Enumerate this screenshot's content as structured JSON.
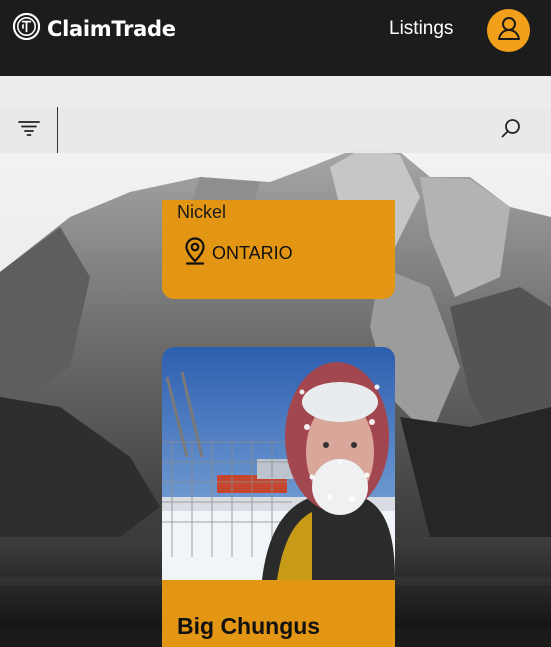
{
  "nav": {
    "brand": "ClaimTrade",
    "links": [
      "Listings"
    ]
  },
  "search": {
    "placeholder": "",
    "value": ""
  },
  "listings": [
    {
      "mineral": "Nickel",
      "location": "ONTARIO"
    },
    {
      "title": "Big Chungus"
    }
  ],
  "colors": {
    "nav_bg": "#1c1c1c",
    "accent": "#f2a01c",
    "card": "#e39613"
  }
}
